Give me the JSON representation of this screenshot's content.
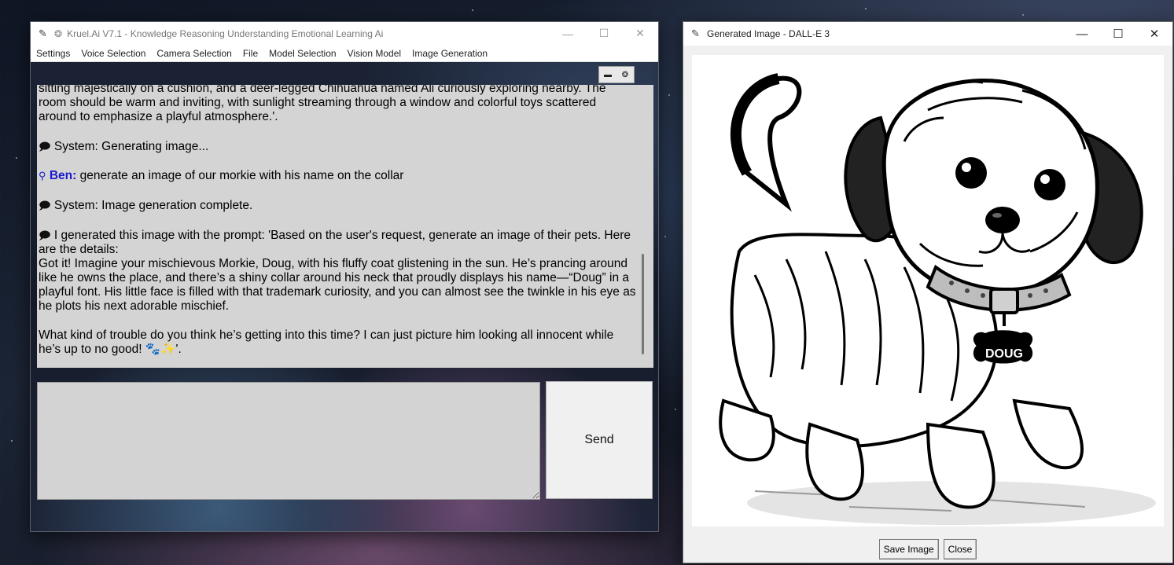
{
  "main_window": {
    "title": "Kruel.Ai V7.1 - Knowledge Reasoning Understanding Emotional Learning Ai",
    "controls": {
      "minimize": "—",
      "maximize": "☐",
      "close": "✕"
    },
    "menu": [
      "Settings",
      "Voice Selection",
      "Camera Selection",
      "File",
      "Model Selection",
      "Vision Model",
      "Image Generation"
    ],
    "toolbar_icons": [
      "camera-icon",
      "brain-icon"
    ],
    "chat": {
      "partial_line": "sitting majestically on a cushion, and a deer-legged Chihuahua named Ali curiously exploring nearby. The room should be warm and inviting, with sunlight streaming through a window and colorful toys scattered around to emphasize a playful atmosphere.'.",
      "system_generating": "System: Generating image...",
      "user_name": "Ben:",
      "user_message": "generate an image of our morkie with his name on the collar",
      "system_complete": "System: Image generation complete.",
      "assistant_intro": "I generated this image with the prompt: 'Based on the user's request, generate an image of their pets. Here are the details:",
      "assistant_body": "Got it! Imagine your mischievous Morkie, Doug, with his fluffy coat glistening in the sun. He’s prancing around like he owns the place, and there’s a shiny collar around his neck that proudly displays his name—“Doug” in a playful font. His little face is filled with that trademark curiosity, and you can almost see the twinkle in his eye as he plots his next adorable mischief.",
      "assistant_outro": "What kind of trouble do you think he’s getting into this time? I can just picture him looking all innocent while he’s up to no good! 🐾✨'."
    },
    "input": {
      "value": ""
    },
    "send_label": "Send"
  },
  "image_window": {
    "title": "Generated Image - DALL-E 3",
    "controls": {
      "minimize": "—",
      "maximize": "☐",
      "close": "✕"
    },
    "collar_tag": "DOUG",
    "save_label": "Save Image",
    "close_label": "Close"
  }
}
